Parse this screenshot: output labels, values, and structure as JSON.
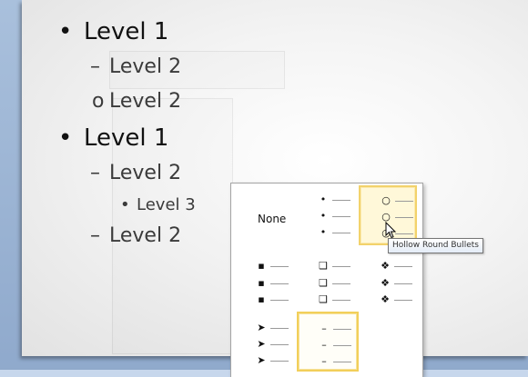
{
  "slide": {
    "levels": [
      {
        "bullet": "•",
        "text": "Level 1"
      },
      {
        "bullet": "–",
        "text": "Level 2"
      },
      {
        "bullet": "o",
        "text": "Level 2"
      },
      {
        "bullet": "•",
        "text": "Level 1"
      },
      {
        "bullet": "–",
        "text": "Level 2"
      },
      {
        "bullet": "•",
        "text": "Level 3"
      },
      {
        "bullet": "–",
        "text": "Level 2"
      }
    ]
  },
  "gallery": {
    "none_label": "None",
    "styles": [
      {
        "name": "None"
      },
      {
        "name": "Filled Round Bullets",
        "symbol": "•"
      },
      {
        "name": "Hollow Round Bullets",
        "symbol": "○"
      },
      {
        "name": "Filled Square Bullets",
        "symbol": "▪"
      },
      {
        "name": "Hollow Square Bullets",
        "symbol": "❑"
      },
      {
        "name": "Star Bullets",
        "symbol": "❖"
      },
      {
        "name": "Arrow Bullets",
        "symbol": "➤"
      },
      {
        "name": "Dash Bullets",
        "symbol": "–"
      }
    ],
    "hovered": "Hollow Round Bullets",
    "selected": "Dash Bullets"
  },
  "tooltip": {
    "text": "Hollow Round Bullets"
  },
  "colors": {
    "hover_border": "#f2d26b",
    "selected_border": "#f2cf5a",
    "window_frame": "#8fa9cc"
  }
}
